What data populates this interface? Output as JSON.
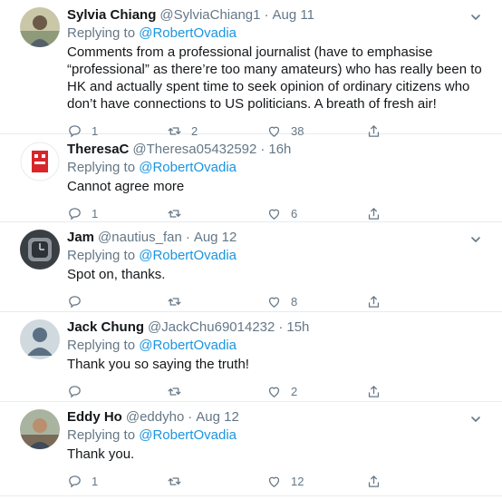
{
  "replying_prefix": "Replying to",
  "tweets": [
    {
      "name": "Sylvia Chiang",
      "handle": "@SylviaChiang1",
      "time": "Aug 11",
      "reply_to": "@RobertOvadia",
      "text": "Comments from a professional journalist (have to emphasise “professional” as there’re too many amateurs) who has really been to HK and actually spent time to seek opinion of ordinary citizens who don’t have connections to US politicians. A breath of fresh air!",
      "replies": "1",
      "retweets": "2",
      "likes": "38",
      "avatar": "woman-photo"
    },
    {
      "name": "TheresaC",
      "handle": "@Theresa05432592",
      "time": "16h",
      "reply_to": "@RobertOvadia",
      "text": "Cannot agree more",
      "replies": "1",
      "retweets": "",
      "likes": "6",
      "avatar": "red-logo"
    },
    {
      "name": "Jam",
      "handle": "@nautius_fan",
      "time": "Aug 12",
      "reply_to": "@RobertOvadia",
      "text": "Spot on, thanks.",
      "replies": "",
      "retweets": "",
      "likes": "8",
      "avatar": "watch-photo"
    },
    {
      "name": "Jack Chung",
      "handle": "@JackChu69014232",
      "time": "15h",
      "reply_to": "@RobertOvadia",
      "text": "Thank you so saying the truth!",
      "replies": "",
      "retweets": "",
      "likes": "2",
      "avatar": "default-avatar"
    },
    {
      "name": "Eddy Ho",
      "handle": "@eddyho",
      "time": "Aug 12",
      "reply_to": "@RobertOvadia",
      "text": "Thank you.",
      "replies": "1",
      "retweets": "",
      "likes": "12",
      "avatar": "man-photo"
    }
  ]
}
